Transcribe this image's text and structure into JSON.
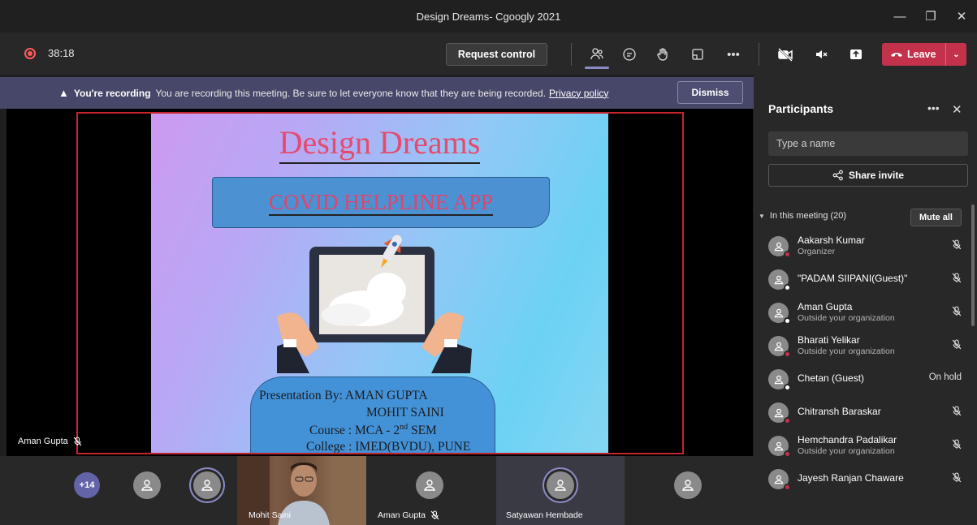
{
  "window": {
    "title": "Design Dreams- Cgoogly 2021"
  },
  "toolbar": {
    "timer": "38:18",
    "request_control": "Request control",
    "leave": "Leave"
  },
  "banner": {
    "bold": "You're recording",
    "text": "You are recording this meeting. Be sure to let everyone know that they are being recorded.",
    "link": "Privacy policy",
    "dismiss": "Dismiss"
  },
  "slide": {
    "title": "Design Dreams",
    "subtitle": "COVID HELPLINE APP",
    "line1": "Presentation By: AMAN GUPTA",
    "line2": "MOHIT SAINI",
    "line3_pre": "Course : MCA - 2",
    "line3_sup": "nd",
    "line3_post": " SEM",
    "line4": "College : IMED(BVDU), PUNE"
  },
  "stage": {
    "presenter": "Aman Gupta"
  },
  "strip": {
    "overflow": "+14",
    "tiles": [
      "Mohit Saini",
      "Aman Gupta",
      "Satyawan Hembade"
    ]
  },
  "panel": {
    "title": "Participants",
    "search_placeholder": "Type a name",
    "share_invite": "Share invite",
    "section": "In this meeting (20)",
    "mute_all": "Mute all",
    "participants": [
      {
        "name": "Aakarsh Kumar",
        "sub": "Organizer",
        "status": "red"
      },
      {
        "name": "\"PADAM SIIPANI(Guest)\"",
        "sub": "",
        "status": "white"
      },
      {
        "name": "Aman Gupta",
        "sub": "Outside your organization",
        "status": "white"
      },
      {
        "name": "Bharati Yelikar",
        "sub": "Outside your organization",
        "status": "red"
      },
      {
        "name": "Chetan (Guest)",
        "sub": "",
        "status": "white",
        "right": "On hold"
      },
      {
        "name": "Chitransh Baraskar",
        "sub": "",
        "status": "red"
      },
      {
        "name": "Hemchandra Padalikar",
        "sub": "Outside your organization",
        "status": "red"
      },
      {
        "name": "Jayesh Ranjan Chaware",
        "sub": "",
        "status": "red"
      }
    ]
  },
  "colors": {
    "leave": "#c4314b",
    "accent": "#6264a7",
    "banner": "#47476a",
    "frame": "#c4242b"
  }
}
